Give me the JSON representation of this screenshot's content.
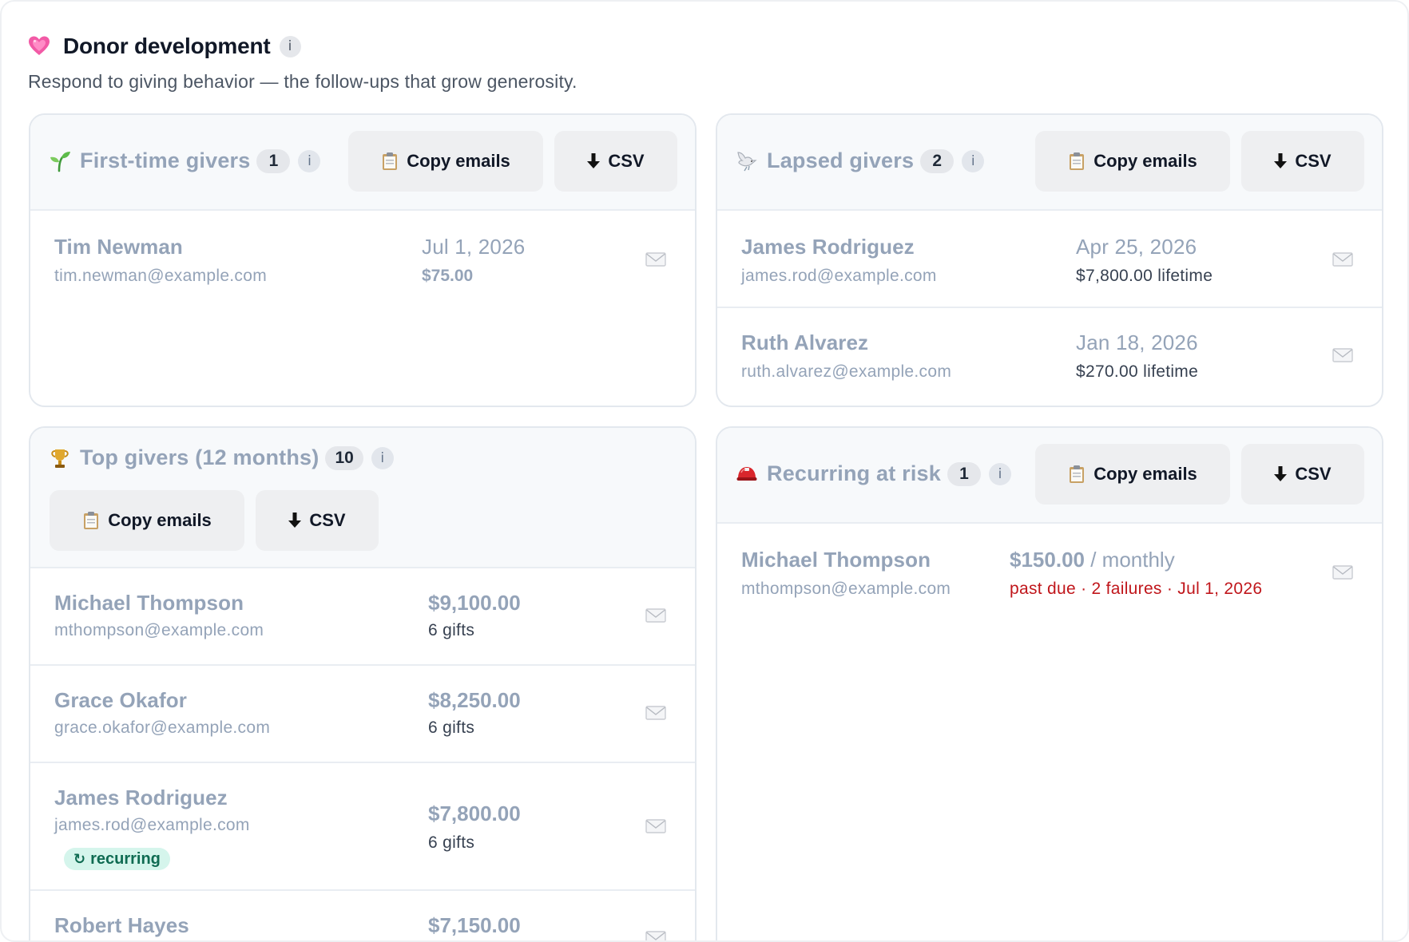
{
  "header": {
    "title": "Donor development",
    "info": "i",
    "subtitle": "Respond to giving behavior — the follow-ups that grow generosity."
  },
  "buttons": {
    "copy_emails": "Copy emails",
    "csv": "CSV"
  },
  "first_time": {
    "title": "First-time givers",
    "count": "1",
    "rows": [
      {
        "name": "Tim Newman",
        "email": "tim.newman@example.com",
        "date": "Jul 1, 2026",
        "amount": "$75.00"
      }
    ]
  },
  "lapsed": {
    "title": "Lapsed givers",
    "count": "2",
    "rows": [
      {
        "name": "James Rodriguez",
        "email": "james.rod@example.com",
        "date": "Apr 25, 2026",
        "lifetime": "$7,800.00 lifetime"
      },
      {
        "name": "Ruth Alvarez",
        "email": "ruth.alvarez@example.com",
        "date": "Jan 18, 2026",
        "lifetime": "$270.00 lifetime"
      }
    ]
  },
  "top": {
    "title": "Top givers (12 months)",
    "count": "10",
    "rows": [
      {
        "name": "Michael Thompson",
        "email": "mthompson@example.com",
        "amount": "$9,100.00",
        "gifts": "6 gifts"
      },
      {
        "name": "Grace Okafor",
        "email": "grace.okafor@example.com",
        "amount": "$8,250.00",
        "gifts": "6 gifts"
      },
      {
        "name": "James Rodriguez",
        "email": "james.rod@example.com",
        "amount": "$7,800.00",
        "gifts": "6 gifts",
        "tag": "recurring"
      },
      {
        "name": "Robert Hayes",
        "amount": "$7,150.00"
      }
    ]
  },
  "at_risk": {
    "title": "Recurring at risk",
    "count": "1",
    "rows": [
      {
        "name": "Michael Thompson",
        "email": "mthompson@example.com",
        "amount": "$150.00",
        "frequency": "/ monthly",
        "status": "past due · 2 failures · Jul 1, 2026"
      }
    ]
  },
  "colors": {
    "muted": "#94a3b8",
    "danger": "#c0161b",
    "tag_bg": "#d5f5ec",
    "tag_fg": "#0f6b52"
  },
  "icons": [
    "heart-icon",
    "sprout-icon",
    "dove-icon",
    "trophy-icon",
    "helmet-icon",
    "clipboard-icon",
    "download-arrow-icon",
    "mail-icon",
    "recurring-icon",
    "info-icon"
  ]
}
